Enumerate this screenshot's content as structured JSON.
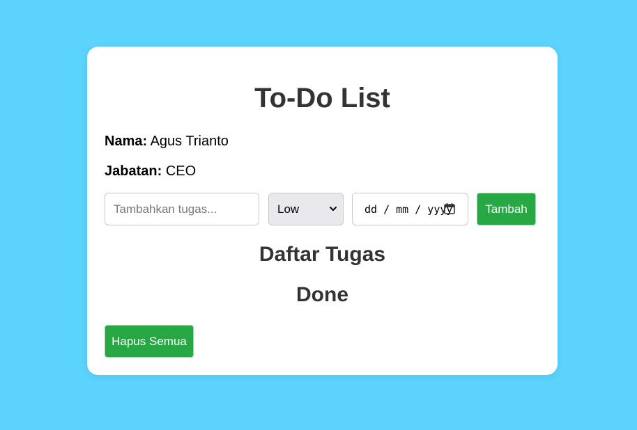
{
  "colors": {
    "page_background": "#5bd3fd",
    "card_background": "#ffffff",
    "button_green": "#28a745",
    "heading_text": "#333333"
  },
  "header": {
    "title": "To-Do List"
  },
  "profile": {
    "name_label": "Nama:",
    "name_value": "Agus Trianto",
    "role_label": "Jabatan:",
    "role_value": "CEO"
  },
  "form": {
    "task_placeholder": "Tambahkan tugas...",
    "priority_selected": "Low",
    "date_placeholder": "dd / mm / yyyy",
    "add_button_label": "Tambah"
  },
  "sections": {
    "task_list_heading": "Daftar Tugas",
    "done_heading": "Done"
  },
  "actions": {
    "clear_all_label": "Hapus Semua"
  },
  "icons": {
    "select_arrow": "chevron-down-icon",
    "date_picker": "calendar-icon"
  }
}
